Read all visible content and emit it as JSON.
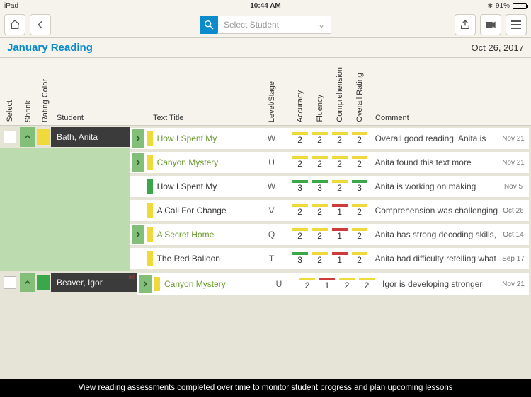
{
  "status": {
    "left": "iPad",
    "time": "10:44 AM",
    "battery_pct": "91%"
  },
  "select_student_placeholder": "Select Student",
  "header": {
    "title": "January Reading",
    "date": "Oct 26, 2017"
  },
  "columns": {
    "select": "Select",
    "shrink": "Shrink",
    "rating_color": "Rating Color",
    "student": "Student",
    "text_title": "Text Title",
    "level": "Level/Stage",
    "accuracy": "Accuracy",
    "fluency": "Fluency",
    "comprehension": "Comprehension",
    "overall": "Overall Rating",
    "comment": "Comment"
  },
  "students": [
    {
      "name": "Bath, Anita",
      "rating_color": "yellow",
      "has_mail": false,
      "rows": [
        {
          "expand": true,
          "mark": "yellow",
          "link": true,
          "title": "How I Spent My",
          "level": "W",
          "scores": [
            {
              "v": "2",
              "c": "yellow"
            },
            {
              "v": "2",
              "c": "yellow"
            },
            {
              "v": "2",
              "c": "yellow"
            },
            {
              "v": "2",
              "c": "yellow"
            }
          ],
          "comment": "Overall good reading. Anita is",
          "date": "Nov 21"
        },
        {
          "expand": true,
          "mark": "yellow",
          "link": true,
          "title": "Canyon Mystery",
          "level": "U",
          "scores": [
            {
              "v": "2",
              "c": "yellow"
            },
            {
              "v": "2",
              "c": "yellow"
            },
            {
              "v": "2",
              "c": "yellow"
            },
            {
              "v": "2",
              "c": "yellow"
            }
          ],
          "comment": "Anita found this text more",
          "date": "Nov 21"
        },
        {
          "expand": false,
          "mark": "green",
          "link": false,
          "title": "How I Spent My",
          "level": "W",
          "scores": [
            {
              "v": "3",
              "c": "green"
            },
            {
              "v": "3",
              "c": "green"
            },
            {
              "v": "2",
              "c": "yellow"
            },
            {
              "v": "3",
              "c": "green"
            }
          ],
          "comment": "Anita is working on making",
          "date": "Nov 5"
        },
        {
          "expand": false,
          "mark": "yellow",
          "link": false,
          "title": "A Call For Change",
          "level": "V",
          "scores": [
            {
              "v": "2",
              "c": "yellow"
            },
            {
              "v": "2",
              "c": "yellow"
            },
            {
              "v": "1",
              "c": "red"
            },
            {
              "v": "2",
              "c": "yellow"
            }
          ],
          "comment": "Comprehension was challenging",
          "date": "Oct 26"
        },
        {
          "expand": true,
          "mark": "yellow",
          "link": true,
          "title": "A Secret Home",
          "level": "Q",
          "scores": [
            {
              "v": "2",
              "c": "yellow"
            },
            {
              "v": "2",
              "c": "yellow"
            },
            {
              "v": "1",
              "c": "red"
            },
            {
              "v": "2",
              "c": "yellow"
            }
          ],
          "comment": "Anita has strong decoding skills,",
          "date": "Oct 14"
        },
        {
          "expand": false,
          "mark": "yellow",
          "link": false,
          "title": "The Red Balloon",
          "level": "T",
          "scores": [
            {
              "v": "3",
              "c": "green"
            },
            {
              "v": "2",
              "c": "yellow"
            },
            {
              "v": "1",
              "c": "red"
            },
            {
              "v": "2",
              "c": "yellow"
            }
          ],
          "comment": "Anita had difficulty retelling what",
          "date": "Sep 17"
        }
      ]
    },
    {
      "name": "Beaver, Igor",
      "rating_color": "green",
      "has_mail": true,
      "rows": [
        {
          "expand": true,
          "mark": "yellow",
          "link": true,
          "title": "Canyon Mystery",
          "level": "U",
          "scores": [
            {
              "v": "2",
              "c": "yellow"
            },
            {
              "v": "1",
              "c": "red"
            },
            {
              "v": "2",
              "c": "yellow"
            },
            {
              "v": "2",
              "c": "yellow"
            }
          ],
          "comment": "Igor is developing stronger",
          "date": "Nov 21"
        }
      ]
    }
  ],
  "footer": "View reading assessments completed over time to monitor student progress and plan upcoming lessons"
}
